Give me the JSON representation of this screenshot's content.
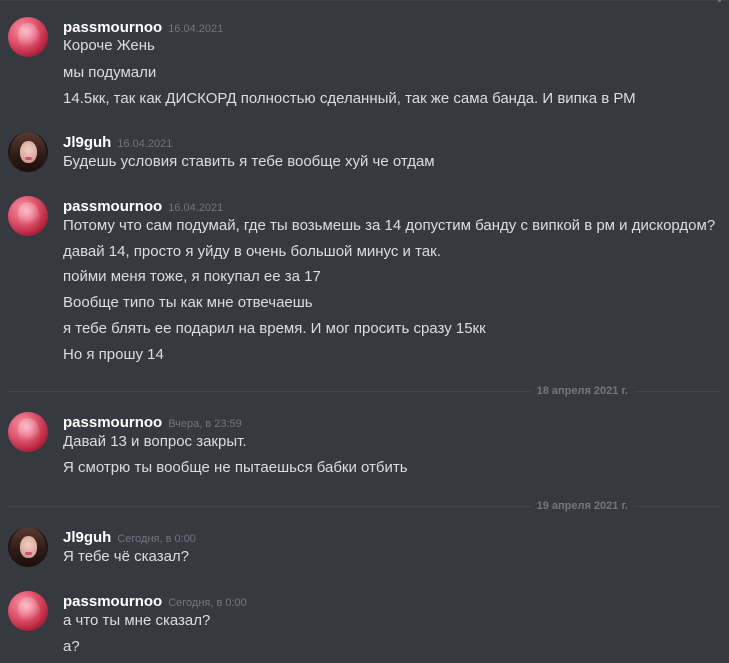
{
  "messages": [
    {
      "author": "passmournoo",
      "timestamp": "16.04.2021",
      "avatar": "pink-abstract-avatar",
      "lines": [
        "Короче Жень",
        "мы подумали",
        "14.5кк, так как ДИСКОРД полностью сделанный, так же сама банда. И випка в РМ"
      ]
    },
    {
      "author": "Jl9guh",
      "timestamp": "16.04.2021",
      "avatar": "girl-portrait-avatar",
      "lines": [
        "Будешь условия ставить я тебе вообще хуй че отдам"
      ]
    },
    {
      "author": "passmournoo",
      "timestamp": "16.04.2021",
      "avatar": "pink-abstract-avatar",
      "lines": [
        "Потому что сам подумай, где ты возьмешь за 14 допустим банду с випкой в рм и дискордом?",
        "давай 14, просто я уйду в очень большой минус и так.",
        "пойми меня тоже, я покупал ее за 17",
        "Вообще типо ты как мне отвечаешь",
        "я тебе блять ее подарил на время. И мог просить сразу 15кк",
        "Но я прошу 14"
      ]
    },
    {
      "author": "passmournoo",
      "timestamp": "Вчера, в 23:59",
      "avatar": "pink-abstract-avatar",
      "lines": [
        "Давай 13 и вопрос закрыт.",
        "Я смотрю ты вообще не пытаешься бабки отбить"
      ]
    },
    {
      "author": "Jl9guh",
      "timestamp": "Сегодня, в 0:00",
      "avatar": "girl-portrait-avatar",
      "lines": [
        "Я тебе чё сказал?"
      ]
    },
    {
      "author": "passmournoo",
      "timestamp": "Сегодня, в 0:00",
      "avatar": "pink-abstract-avatar",
      "lines": [
        "а что ты мне сказал?",
        "а?"
      ]
    }
  ],
  "date_separators": [
    "18 апреля 2021 г.",
    "19 апреля 2021 г."
  ],
  "colors": {
    "background": "#36393f",
    "username": "#ffffff",
    "message_text": "#dcddde",
    "timestamp": "#72767d",
    "separator_line": "#42454a"
  }
}
